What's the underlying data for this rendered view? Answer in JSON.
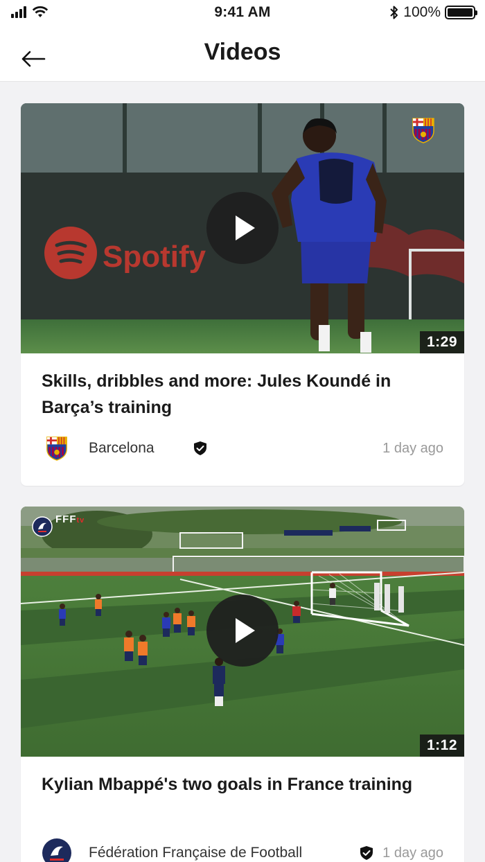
{
  "status_bar": {
    "time": "9:41 AM",
    "battery": "100%"
  },
  "header": {
    "title": "Videos"
  },
  "videos": [
    {
      "title": "Skills, dribbles and more: Jules Koundé in Barça’s training",
      "duration": "1:29",
      "source": "Barcelona",
      "time_ago": "1 day ago",
      "badge": "barcelona-crest",
      "backdrop_text": "Spotify"
    },
    {
      "title": "Kylian Mbappé's two goals in France training",
      "duration": "1:12",
      "source": "Fédération Française de Football",
      "time_ago": "1 day ago",
      "badge": "fff-crest",
      "overlay_label": "FFF",
      "overlay_label_sup": "tv"
    }
  ],
  "colors": {
    "background": "#f2f2f4",
    "card": "#ffffff",
    "barca_blue": "#1f3f9e",
    "barca_red": "#a50044",
    "pitch_green": "#4f8a3c",
    "fff_navy": "#1d2a5c"
  }
}
